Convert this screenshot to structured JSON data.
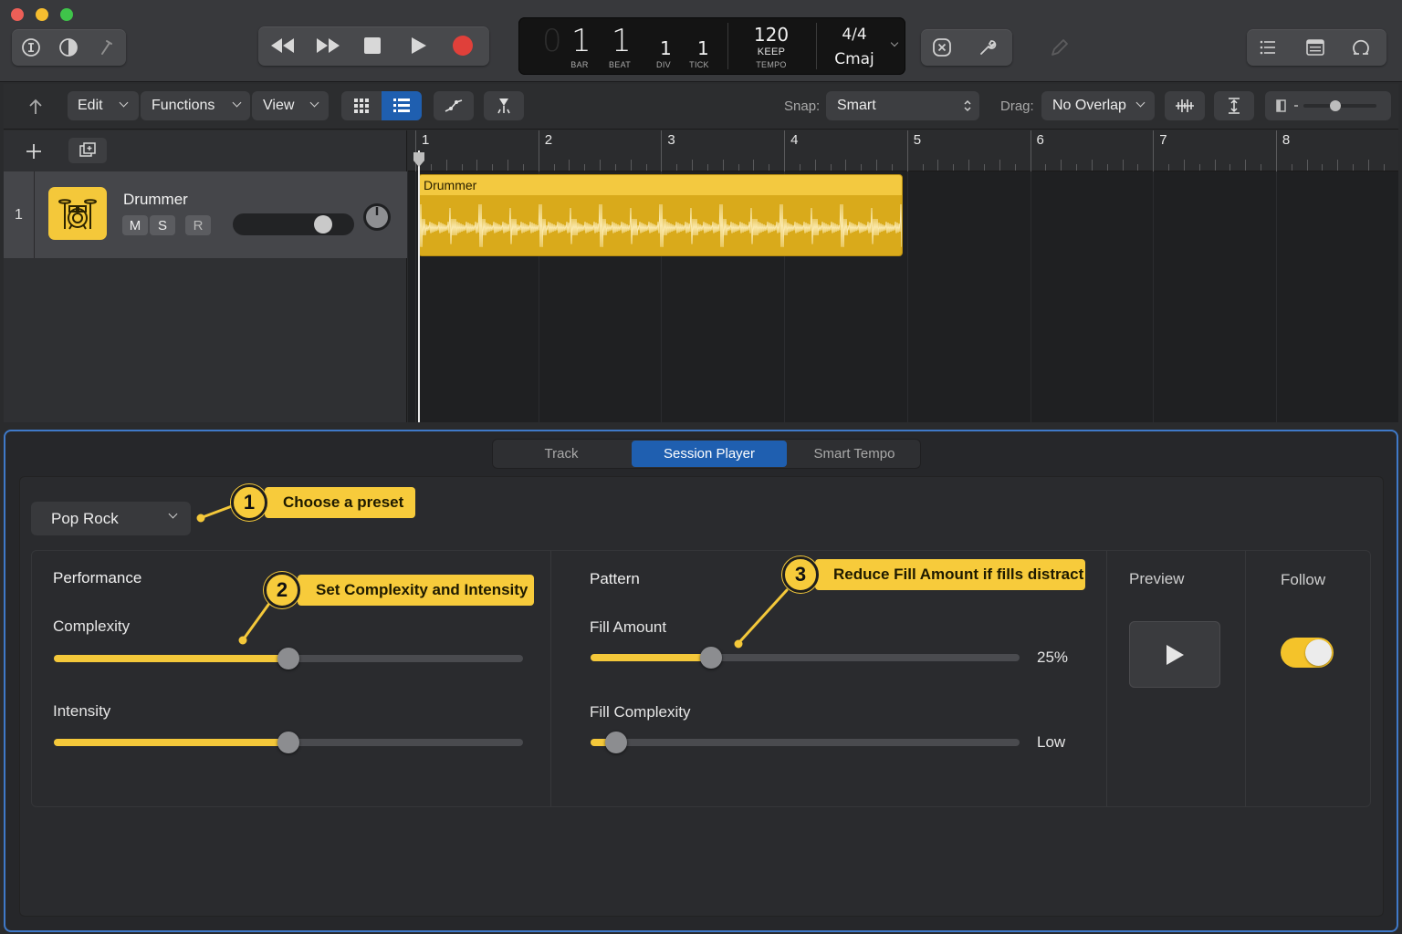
{
  "colors": {
    "accent_yellow": "#f4c83a",
    "selected_blue": "#1f5fb0",
    "panel_border": "#3f79c8",
    "record_red": "#e0403a"
  },
  "window": {
    "traffic_lights": [
      "close",
      "minimize",
      "zoom"
    ]
  },
  "control_bar": {
    "left_icons": [
      "info-icon",
      "contrast-icon",
      "edit-tool-icon"
    ],
    "transport": [
      "rewind-icon",
      "fast-forward-icon",
      "stop-icon",
      "play-icon",
      "record-icon"
    ],
    "lcd": {
      "bar": "1",
      "beat": "1",
      "div": "1",
      "tick": "1",
      "bar_cap": "BAR",
      "beat_cap": "BEAT",
      "div_cap": "DIV",
      "tick_cap": "TICK",
      "tempo": "120",
      "tempo_mode": "KEEP",
      "tempo_cap": "TEMPO",
      "signature": "4/4",
      "key": "Cmaj"
    },
    "mid_icons": [
      "close-circle-icon",
      "wrench-icon",
      "pencil-icon"
    ],
    "right_icons": [
      "list-icon",
      "note-pad-icon",
      "loop-browser-icon"
    ]
  },
  "toolbar": {
    "edit": "Edit",
    "functions": "Functions",
    "view": "View",
    "snap_label": "Snap:",
    "snap_value": "Smart",
    "drag_label": "Drag:",
    "drag_value": "No Overlap"
  },
  "tracks": [
    {
      "number": "1",
      "name": "Drummer",
      "mute": "M",
      "solo": "S",
      "record": "R",
      "volume": 0.8
    }
  ],
  "ruler": {
    "bars": [
      "1",
      "2",
      "3",
      "4",
      "5",
      "6",
      "7",
      "8"
    ]
  },
  "region": {
    "name": "Drummer"
  },
  "panel": {
    "tabs": [
      {
        "label": "Track",
        "active": false
      },
      {
        "label": "Session Player",
        "active": true
      },
      {
        "label": "Smart Tempo",
        "active": false
      }
    ],
    "preset": "Pop Rock",
    "performance": {
      "heading": "Performance",
      "complexity_label": "Complexity",
      "complexity_value": 0.5,
      "intensity_label": "Intensity",
      "intensity_value": 0.5
    },
    "pattern": {
      "heading": "Pattern",
      "fill_amount_label": "Fill Amount",
      "fill_amount_value": 0.28,
      "fill_amount_text": "25%",
      "fill_complexity_label": "Fill Complexity",
      "fill_complexity_value": 0.06,
      "fill_complexity_text": "Low"
    },
    "preview_label": "Preview",
    "follow_label": "Follow",
    "follow_on": true
  },
  "callouts": [
    {
      "number": "1",
      "text": "Choose a preset"
    },
    {
      "number": "2",
      "text": "Set Complexity and Intensity"
    },
    {
      "number": "3",
      "text": "Reduce Fill Amount if fills distract"
    }
  ]
}
